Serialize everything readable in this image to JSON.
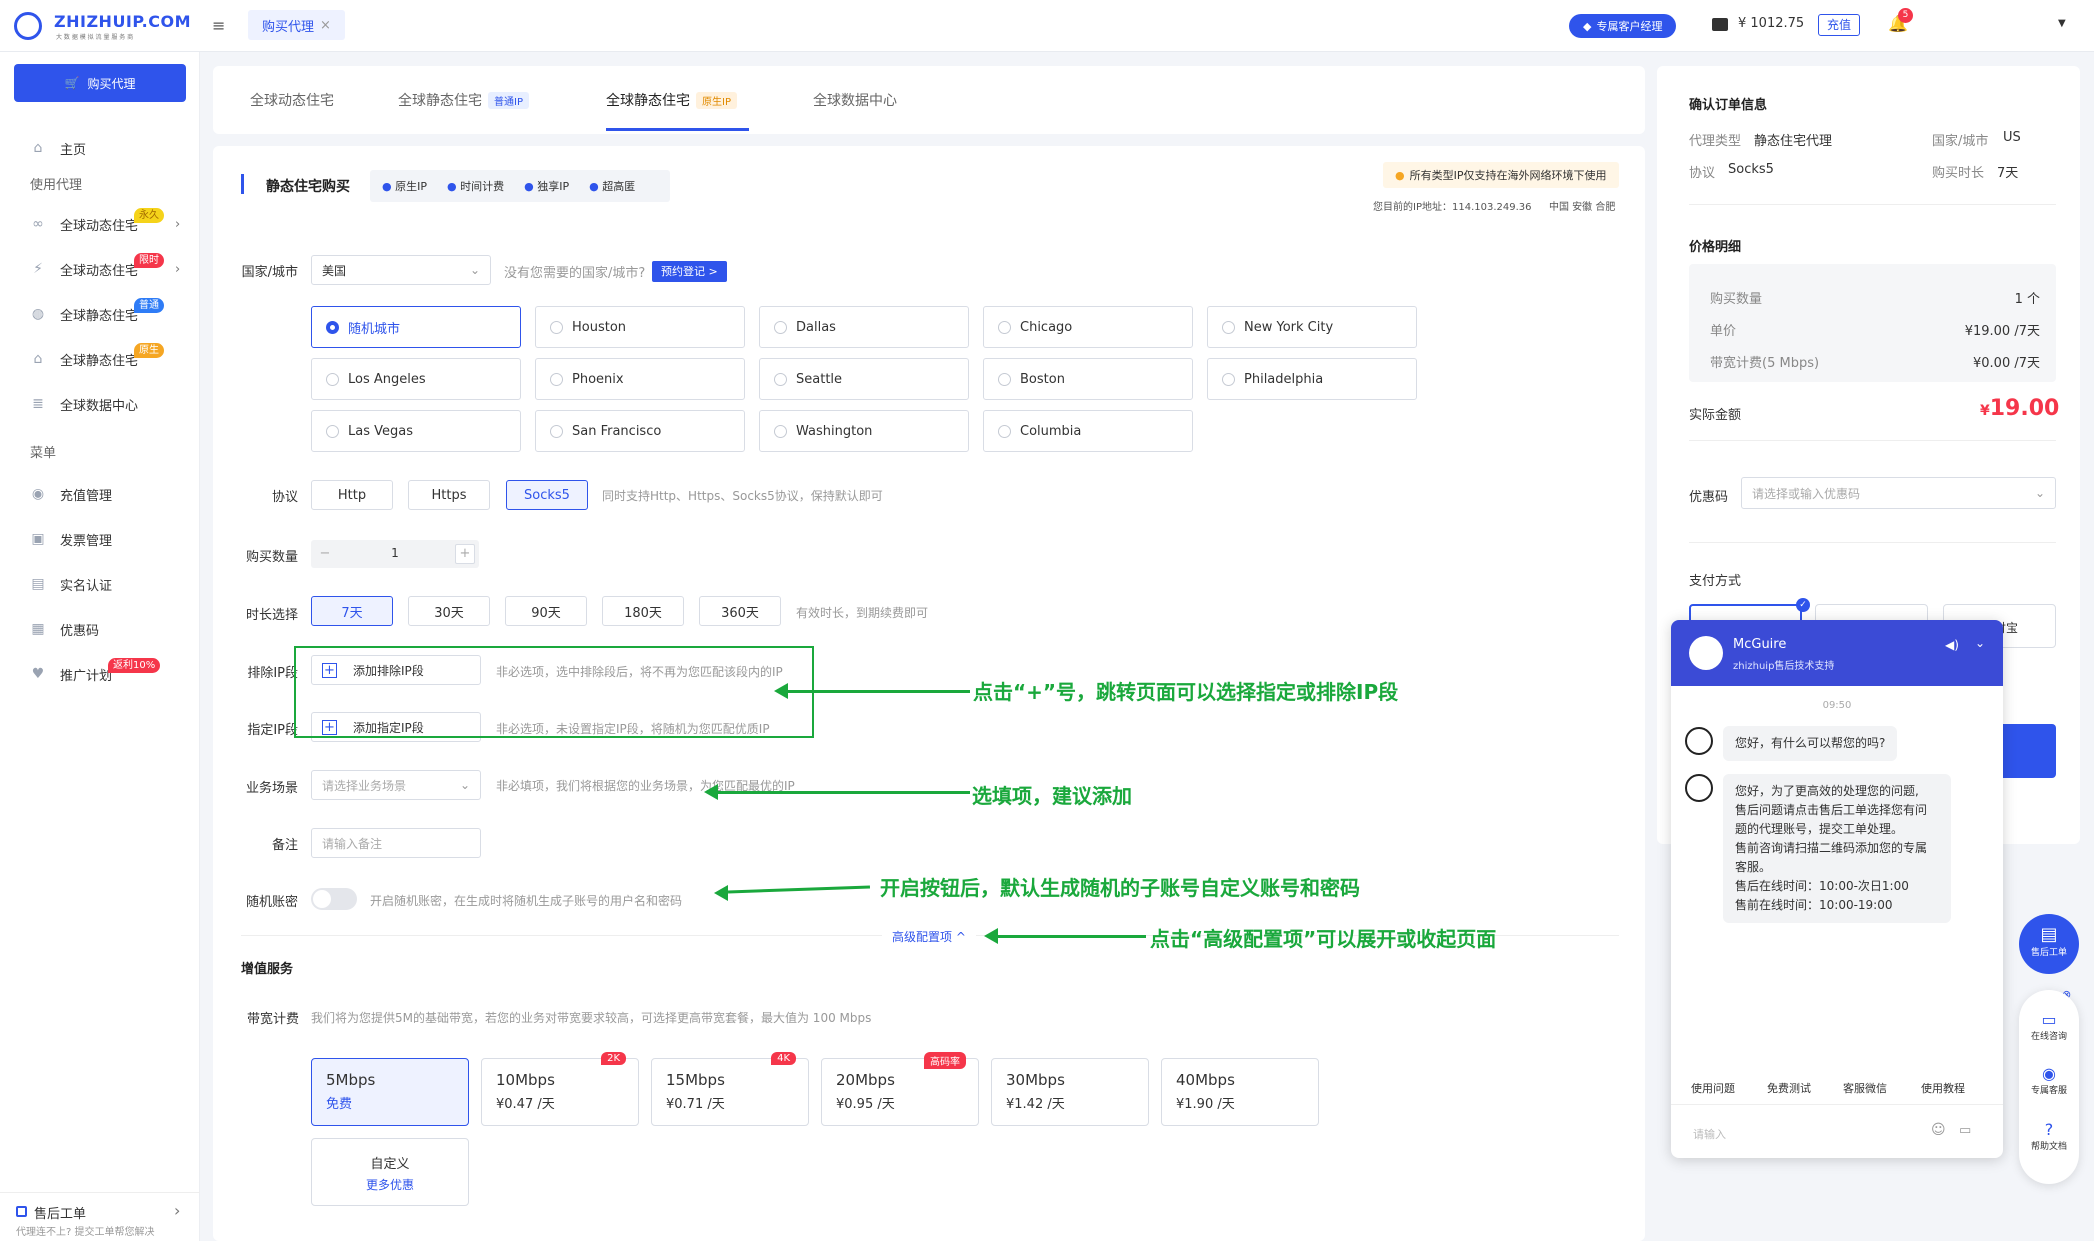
{
  "header": {
    "logo": "ZHIZHUIP.COM",
    "logo_sub": "大 数 据 模 拟 流 量 服 务 商",
    "tab": "购买代理",
    "manager_btn": "专属客户经理",
    "balance": "¥ 1012.75",
    "recharge": "充值",
    "notif_count": "5"
  },
  "sidebar": {
    "buy_btn": "购买代理",
    "home": "主页",
    "group1": "使用代理",
    "items": [
      {
        "label": "全球动态住宅",
        "badge": "永久",
        "badge_color": "#f5d31a"
      },
      {
        "label": "全球动态住宅",
        "badge": "限时",
        "badge_color": "#f5364a"
      },
      {
        "label": "全球静态住宅",
        "badge": "普通",
        "badge_color": "#2f7cf6"
      },
      {
        "label": "全球静态住宅",
        "badge": "原生",
        "badge_color": "#f5a623"
      },
      {
        "label": "全球数据中心",
        "badge": ""
      }
    ],
    "group2": "菜单",
    "menu": [
      "充值管理",
      "发票管理",
      "实名认证",
      "优惠码",
      "推广计划"
    ],
    "promo_badge": "返利10%",
    "after_sale": "售后工单",
    "after_sale_sub": "代理连不上? 提交工单帮您解决"
  },
  "tabs": [
    {
      "label": "全球动态住宅",
      "tag": ""
    },
    {
      "label": "全球静态住宅",
      "tag": "普通IP"
    },
    {
      "label": "全球静态住宅",
      "tag": "原生IP"
    },
    {
      "label": "全球数据中心",
      "tag": ""
    }
  ],
  "section": {
    "title": "静态住宅购买",
    "features": [
      "原生IP",
      "时间计费",
      "独享IP",
      "超高匿"
    ],
    "notice": "所有类型IP仅支持在海外网络环境下使用",
    "ip_line": "您目前的IP地址：114.103.249.36",
    "loc": "中国 安徽 合肥"
  },
  "form": {
    "country_label": "国家/城市",
    "country_value": "美国",
    "country_hint": "没有您需要的国家/城市?",
    "reserve_btn": "预约登记 >",
    "cities": [
      "随机城市",
      "Houston",
      "Dallas",
      "Chicago",
      "New York City",
      "Los Angeles",
      "Phoenix",
      "Seattle",
      "Boston",
      "Philadelphia",
      "Las Vegas",
      "San Francisco",
      "Washington",
      "Columbia"
    ],
    "protocol_label": "协议",
    "protocols": [
      "Http",
      "Https",
      "Socks5"
    ],
    "protocol_hint": "同时支持Http、Https、Socks5协议，保持默认即可",
    "qty_label": "购买数量",
    "qty": "1",
    "qty_minus": "−",
    "qty_plus": "+",
    "dur_label": "时长选择",
    "durations": [
      "7天",
      "30天",
      "90天",
      "180天",
      "360天"
    ],
    "dur_hint": "有效时长，到期续费即可",
    "exclude_label": "排除IP段",
    "exclude_btn": "添加排除IP段",
    "exclude_hint": "非必选项，选中排除段后，将不再为您匹配该段内的IP",
    "include_label": "指定IP段",
    "include_btn": "添加指定IP段",
    "include_hint": "非必选项，未设置指定IP段，将随机为您匹配优质IP",
    "scene_label": "业务场景",
    "scene_ph": "请选择业务场景",
    "scene_hint": "非必填项，我们将根据您的业务场景，为您匹配最优的IP",
    "note_label": "备注",
    "note_ph": "请输入备注",
    "random_label": "随机账密",
    "random_hint": "开启随机账密，在生成时将随机生成子账号的用户名和密码",
    "advanced": "高级配置项 ^",
    "value_add": "增值服务",
    "bw_label": "带宽计费",
    "bw_hint": "我们将为您提供5M的基础带宽，若您的业务对带宽要求较高，可选择更高带宽套餐，最大值为 100 Mbps",
    "bandwidth": [
      {
        "n": "5Mbps",
        "p": "免费",
        "tag": ""
      },
      {
        "n": "10Mbps",
        "p": "¥0.47 /天",
        "tag": "2K"
      },
      {
        "n": "15Mbps",
        "p": "¥0.71 /天",
        "tag": "4K"
      },
      {
        "n": "20Mbps",
        "p": "¥0.95 /天",
        "tag": "高码率"
      },
      {
        "n": "30Mbps",
        "p": "¥1.42 /天",
        "tag": ""
      },
      {
        "n": "40Mbps",
        "p": "¥1.90 /天",
        "tag": ""
      }
    ],
    "custom": "自定义",
    "custom_sub": "更多优惠"
  },
  "annotations": [
    "点击“+”号，跳转页面可以选择指定或排除IP段",
    "选填项，建议添加",
    "开启按钮后，默认生成随机的子账号自定义账号和密码",
    "点击“高级配置项”可以展开或收起页面"
  ],
  "order": {
    "title": "确认订单信息",
    "type_k": "代理类型",
    "type_v": "静态住宅代理",
    "country_k": "国家/城市",
    "country_v": "US",
    "proto_k": "协议",
    "proto_v": "Socks5",
    "dur_k": "购买时长",
    "dur_v": "7天",
    "price_title": "价格明细",
    "qty_k": "购买数量",
    "qty_v": "1 个",
    "unit_k": "单价",
    "unit_v": "¥19.00 /7天",
    "bw_k": "带宽计费(5 Mbps)",
    "bw_v": "¥0.00 /7天",
    "total_k": "实际金额",
    "total_v": "19.00",
    "total_cur": "¥",
    "coupon_k": "优惠码",
    "coupon_ph": "请选择或输入优惠码",
    "pay_title": "支付方式",
    "pay_alipay": "付宝"
  },
  "chat": {
    "name": "McGuire",
    "sub": "zhizhuip售后技术支持",
    "time": "09:50",
    "msg1": "您好，有什么可以帮您的吗?",
    "msg2": [
      "您好，为了更高效的处理您的问题,",
      "售后问题请点击售后工单选择您有问",
      "题的代理账号，提交工单处理。",
      "售前咨询请扫描二维码添加您的专属",
      "客服。",
      "售后在线时间：10:00-次日1:00",
      "售前在线时间：10:00-19:00"
    ],
    "quick": [
      "使用问题",
      "免费测试",
      "客服微信",
      "使用教程"
    ],
    "input_ph": "请输入"
  },
  "float": {
    "ticket": "售后工单",
    "online": "在线咨询",
    "service": "专属客服",
    "help": "帮助文档"
  }
}
